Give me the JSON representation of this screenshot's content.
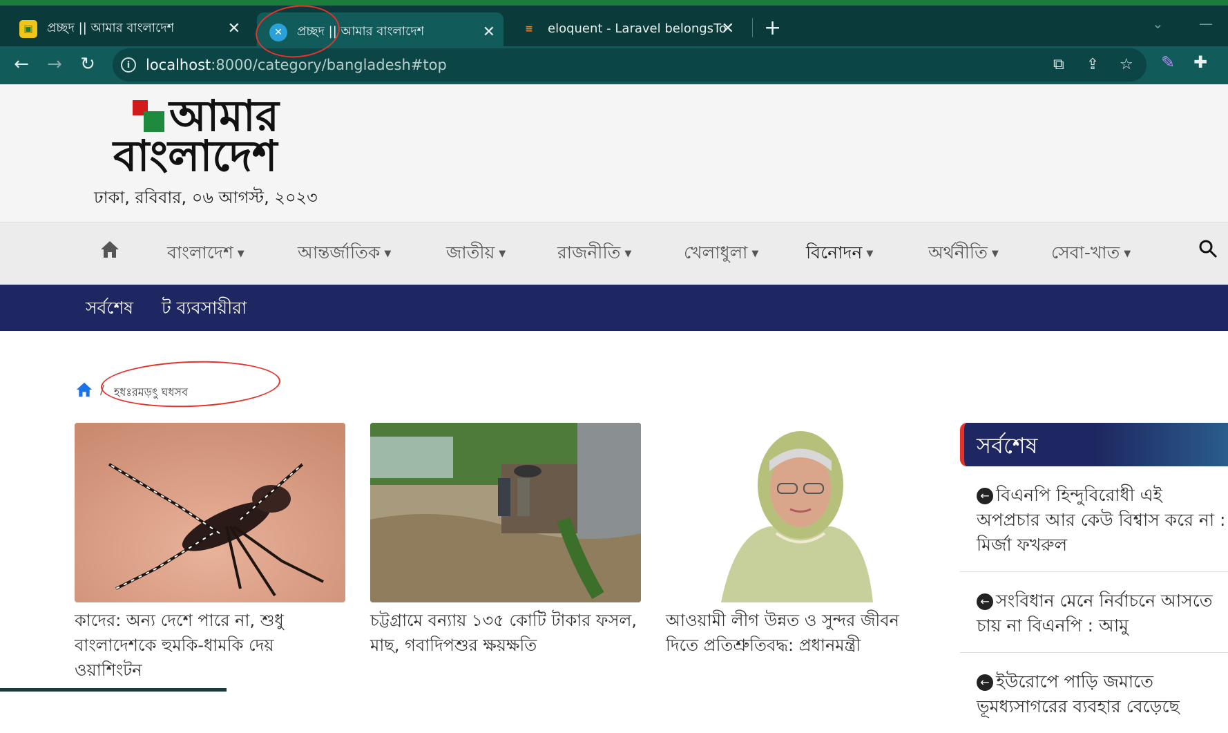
{
  "browser": {
    "tabs": [
      {
        "title": "প্রচ্ছদ || আমার বাংলাদেশ",
        "active": false
      },
      {
        "title": "প্রচ্ছদ || আমার বাংলাদেশ",
        "active": true
      },
      {
        "title": "eloquent - Laravel belongsTo & h",
        "active": false
      }
    ],
    "url_host": "localhost",
    "url_rest": ":8000/category/bangladesh#top"
  },
  "site": {
    "logo_line1": "আমার",
    "logo_line2": "বাংলাদেশ",
    "dateline": "ঢাকা, রবিবার, ০৬ আগস্ট, ২০২৩"
  },
  "menu": [
    {
      "label": "বাংলাদেশ",
      "active": false
    },
    {
      "label": "আন্তর্জাতিক",
      "active": false
    },
    {
      "label": "জাতীয়",
      "active": false
    },
    {
      "label": "রাজনীতি",
      "active": false
    },
    {
      "label": "খেলাধুলা",
      "active": false
    },
    {
      "label": "বিনোদন",
      "active": true
    },
    {
      "label": "অর্থনীতি",
      "active": false
    },
    {
      "label": "সেবা-খাত",
      "active": false
    }
  ],
  "subnav": [
    "সর্বশেষ",
    "ট ব্যবসায়ীরা"
  ],
  "breadcrumb": {
    "sep": "/",
    "current": "হধঃরমড়ৎু ঘধসব"
  },
  "cards": [
    {
      "caption": "কাদের: অন্য দেশে পারে না, শুধু বাংলাদেশকে হুমকি-ধামকি দেয় ওয়াশিংটন",
      "image": "mosquito"
    },
    {
      "caption": "চট্টগ্রামে বন্যায় ১৩৫ কোটি টাকার ফসল, মাছ, গবাদিপশুর ক্ষয়ক্ষতি",
      "image": "flood"
    },
    {
      "caption": "আওয়ামী লীগ উন্নত ও সুন্দর জীবন দিতে প্রতিশ্রুতিবদ্ধ: প্রধানমন্ত্রী",
      "image": "portrait"
    }
  ],
  "sidebar": {
    "title": "সর্বশেষ",
    "items": [
      "বিএনপি হিন্দুবিরোধী এই অপপ্রচার আর কেউ বিশ্বাস করে না : মির্জা ফখরুল",
      "সংবিধান মেনে নির্বাচনে আসতে চায় না বিএনপি : আমু",
      "ইউরোপে পাড়ি জমাতে ভূমধ্যসাগরের ব্যবহার বেড়েছে"
    ]
  },
  "colors": {
    "tabbar": "#0b3a3a",
    "toolbar": "#115b5b",
    "subnav": "#1e2761",
    "accent_red": "#e4332a"
  }
}
